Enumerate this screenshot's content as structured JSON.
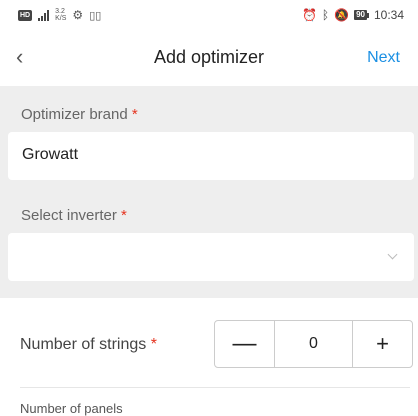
{
  "status_bar": {
    "hd": "HD",
    "network": "4G",
    "speed_value": "3.2",
    "speed_unit": "K/S",
    "time": "10:34",
    "battery": "90"
  },
  "nav": {
    "title": "Add optimizer",
    "next_label": "Next",
    "back_glyph": "‹"
  },
  "form": {
    "brand_label": "Optimizer brand",
    "brand_value": "Growatt",
    "inverter_label": "Select inverter",
    "inverter_value": "",
    "required_mark": "*",
    "strings_label": "Number of strings",
    "strings_value": "0",
    "minus": "—",
    "plus": "+",
    "panels_label": "Number of panels"
  }
}
